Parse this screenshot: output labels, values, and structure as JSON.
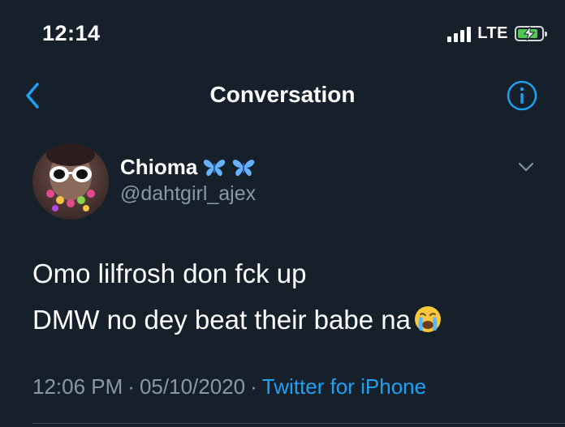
{
  "status_bar": {
    "time": "12:14",
    "network": "LTE",
    "battery_state": "charging"
  },
  "nav": {
    "title": "Conversation",
    "back_icon": "chevron-left-icon",
    "info_icon": "info-circle-icon"
  },
  "tweet": {
    "author": {
      "name": "Chioma",
      "name_emoji": "butterfly-icon",
      "handle": "@dahtgirl_ajex"
    },
    "text_line1": "Omo lilfrosh don fck up",
    "text_line2": "DMW no dey beat their babe na",
    "text_emoji": "crying-face-emoji",
    "time": "12:06 PM",
    "separator": "·",
    "date": "05/10/2020",
    "source": "Twitter for iPhone"
  },
  "colors": {
    "background": "#15202b",
    "accent": "#1da1f2",
    "secondary_text": "#8899a6",
    "butterfly": "#66b2ff"
  }
}
